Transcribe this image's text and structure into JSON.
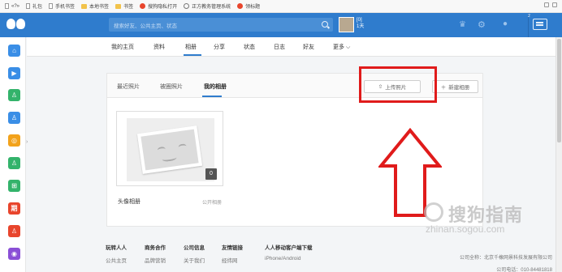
{
  "bookmarks": [
    {
      "label": "«?»",
      "icon": "page-icon"
    },
    {
      "label": "礼包",
      "icon": "page-icon"
    },
    {
      "label": "手机书签",
      "icon": "page-icon"
    },
    {
      "label": "本地书签",
      "icon": "folder-icon"
    },
    {
      "label": "书签",
      "icon": "folder-icon"
    },
    {
      "label": "搜狗隐私打开",
      "icon": "sogou-icon"
    },
    {
      "label": "正方教务管理系统",
      "icon": "globe-icon"
    },
    {
      "label": "领标题",
      "icon": "sogou-icon"
    }
  ],
  "topnav": {
    "search_placeholder": "搜索好友、公共主页、状态",
    "user_name": "[0]",
    "user_sub": "1天",
    "chat_badge": "2"
  },
  "sidebar": {
    "items": [
      {
        "glyph": "⌂",
        "color": "#3a8ee6",
        "name": "home"
      },
      {
        "glyph": "▶",
        "color": "#3a8ee6",
        "name": "video"
      },
      {
        "glyph": "♙",
        "color": "#33b36b",
        "name": "friends"
      },
      {
        "glyph": "♙",
        "color": "#3a8ee6",
        "name": "profile"
      },
      {
        "glyph": "◎",
        "color": "#f2a21b",
        "name": "apps"
      },
      {
        "glyph": "♙",
        "color": "#33b36b",
        "name": "contacts"
      },
      {
        "glyph": "⊞",
        "color": "#33b36b",
        "name": "games"
      },
      {
        "glyph": "期",
        "color": "#e8452c",
        "name": "events"
      },
      {
        "glyph": "♙",
        "color": "#e8452c",
        "name": "groups"
      },
      {
        "glyph": "◉",
        "color": "#8a4fd6",
        "name": "chat"
      }
    ]
  },
  "subnav": {
    "tabs": [
      "我的主页",
      "资料",
      "相册",
      "分享",
      "状态",
      "日志",
      "好友",
      "更多 ⌵"
    ]
  },
  "album_panel": {
    "tabs": [
      "最近照片",
      "被圈照片",
      "我的相册"
    ],
    "upload_label": "上传照片",
    "new_album_label": "新建相册",
    "albums": [
      {
        "name": "头像相册",
        "privacy": "公开相册",
        "count": "0"
      }
    ]
  },
  "footer": {
    "columns": [
      {
        "title": "玩转人人",
        "link": "公共主页"
      },
      {
        "title": "商务合作",
        "link": "品牌营销"
      },
      {
        "title": "公司信息",
        "link": "关于我们"
      },
      {
        "title": "友情链接",
        "link": "经纬网"
      },
      {
        "title": "人人移动客户端下载",
        "link": "iPhone/Android"
      }
    ],
    "company": "公司全称：北京千橡网景科技发展有限公司",
    "phone": "公司电话：010-84481818"
  },
  "watermark": {
    "brand": "搜狗指南",
    "url": "zhinan.sogou.com"
  },
  "colors": {
    "brand_blue": "#2f7ccd",
    "highlight_red": "#e01b1b"
  }
}
